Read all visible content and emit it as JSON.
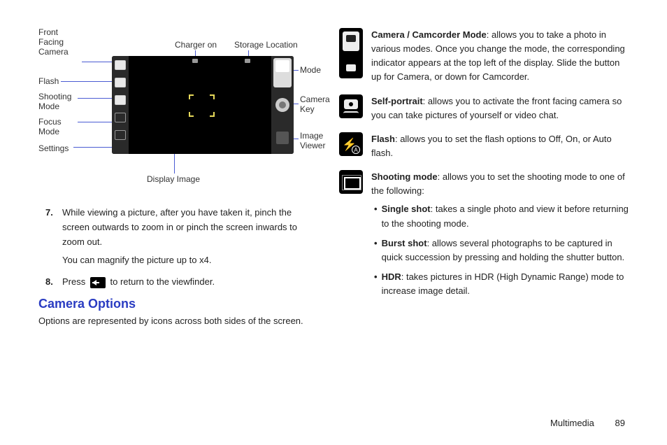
{
  "diagram": {
    "labels": {
      "front_facing_camera": "Front Facing Camera",
      "flash": "Flash",
      "shooting_mode": "Shooting Mode",
      "focus_mode": "Focus Mode",
      "settings": "Settings",
      "charger_on": "Charger on",
      "storage_location": "Storage Location",
      "mode": "Mode",
      "camera_key": "Camera Key",
      "image_viewer": "Image Viewer",
      "display_image": "Display Image"
    }
  },
  "steps": {
    "s7": {
      "num": "7.",
      "text": "While viewing a picture, after you have taken it, pinch the screen outwards to zoom in or pinch the screen inwards to zoom out.",
      "sub": "You can magnify the picture up to x4."
    },
    "s8": {
      "num": "8.",
      "pre": "Press",
      "post": "to return to the viewfinder."
    }
  },
  "section": {
    "heading": "Camera Options",
    "body": "Options are represented by icons across both sides of the screen."
  },
  "options": {
    "mode": {
      "title": "Camera / Camcorder Mode",
      "text": ": allows you to take a photo in various modes. Once you change the mode, the corresponding indicator appears at the top left of the display. Slide the button up for Camera, or down for Camcorder."
    },
    "selfie": {
      "title": "Self-portrait",
      "text": ": allows you to activate the front facing camera so you can take pictures of yourself or video chat."
    },
    "flash": {
      "title": "Flash",
      "text": ": allows you to set the flash options to Off, On, or Auto flash."
    },
    "shoot": {
      "title": "Shooting mode",
      "text": ": allows you to set the shooting mode to one of the following:",
      "bullets": [
        {
          "title": "Single shot",
          "text": ": takes a single photo and view it before returning to the shooting mode."
        },
        {
          "title": "Burst shot",
          "text": ": allows several photographs to be captured in quick succession by pressing and holding the shutter button."
        },
        {
          "title": "HDR",
          "text": ": takes pictures in HDR (High Dynamic Range) mode to increase image detail."
        }
      ]
    }
  },
  "footer": {
    "section": "Multimedia",
    "page": "89"
  }
}
